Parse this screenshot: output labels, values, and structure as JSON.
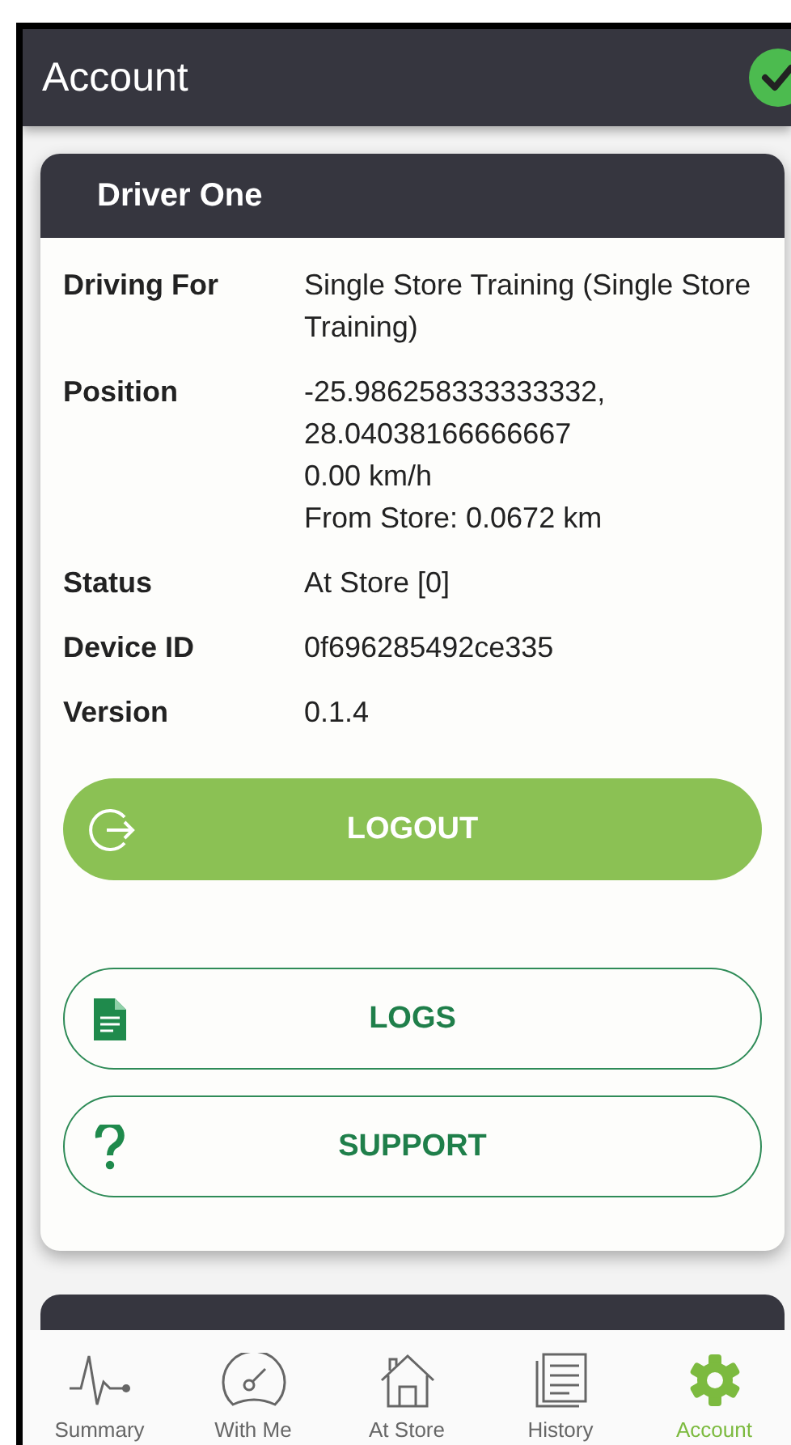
{
  "header": {
    "title": "Account",
    "connected": true
  },
  "card": {
    "title": "Driver One",
    "rows": [
      {
        "label": "Driving For",
        "lines": [
          "Single Store Training (Single Store Training)"
        ]
      },
      {
        "label": "Position",
        "lines": [
          "-25.986258333333332,",
          "28.04038166666667",
          "0.00 km/h",
          "From Store: 0.0672 km"
        ]
      },
      {
        "label": "Status",
        "lines": [
          "At Store [0]"
        ]
      },
      {
        "label": "Device ID",
        "lines": [
          "0f696285492ce335"
        ]
      },
      {
        "label": "Version",
        "lines": [
          "0.1.4"
        ]
      }
    ],
    "buttons": [
      {
        "label": "LOGOUT",
        "kind": "logout"
      },
      {
        "label": "LOGS",
        "kind": "logs"
      },
      {
        "label": "SUPPORT",
        "kind": "support"
      }
    ]
  },
  "nav": [
    {
      "label": "Summary",
      "kind": "pulse",
      "selected": false
    },
    {
      "label": "With Me",
      "kind": "gauge",
      "selected": false
    },
    {
      "label": "At Store",
      "kind": "house",
      "selected": false
    },
    {
      "label": "History",
      "kind": "document",
      "selected": false
    },
    {
      "label": "Account",
      "kind": "gear",
      "selected": true
    }
  ]
}
